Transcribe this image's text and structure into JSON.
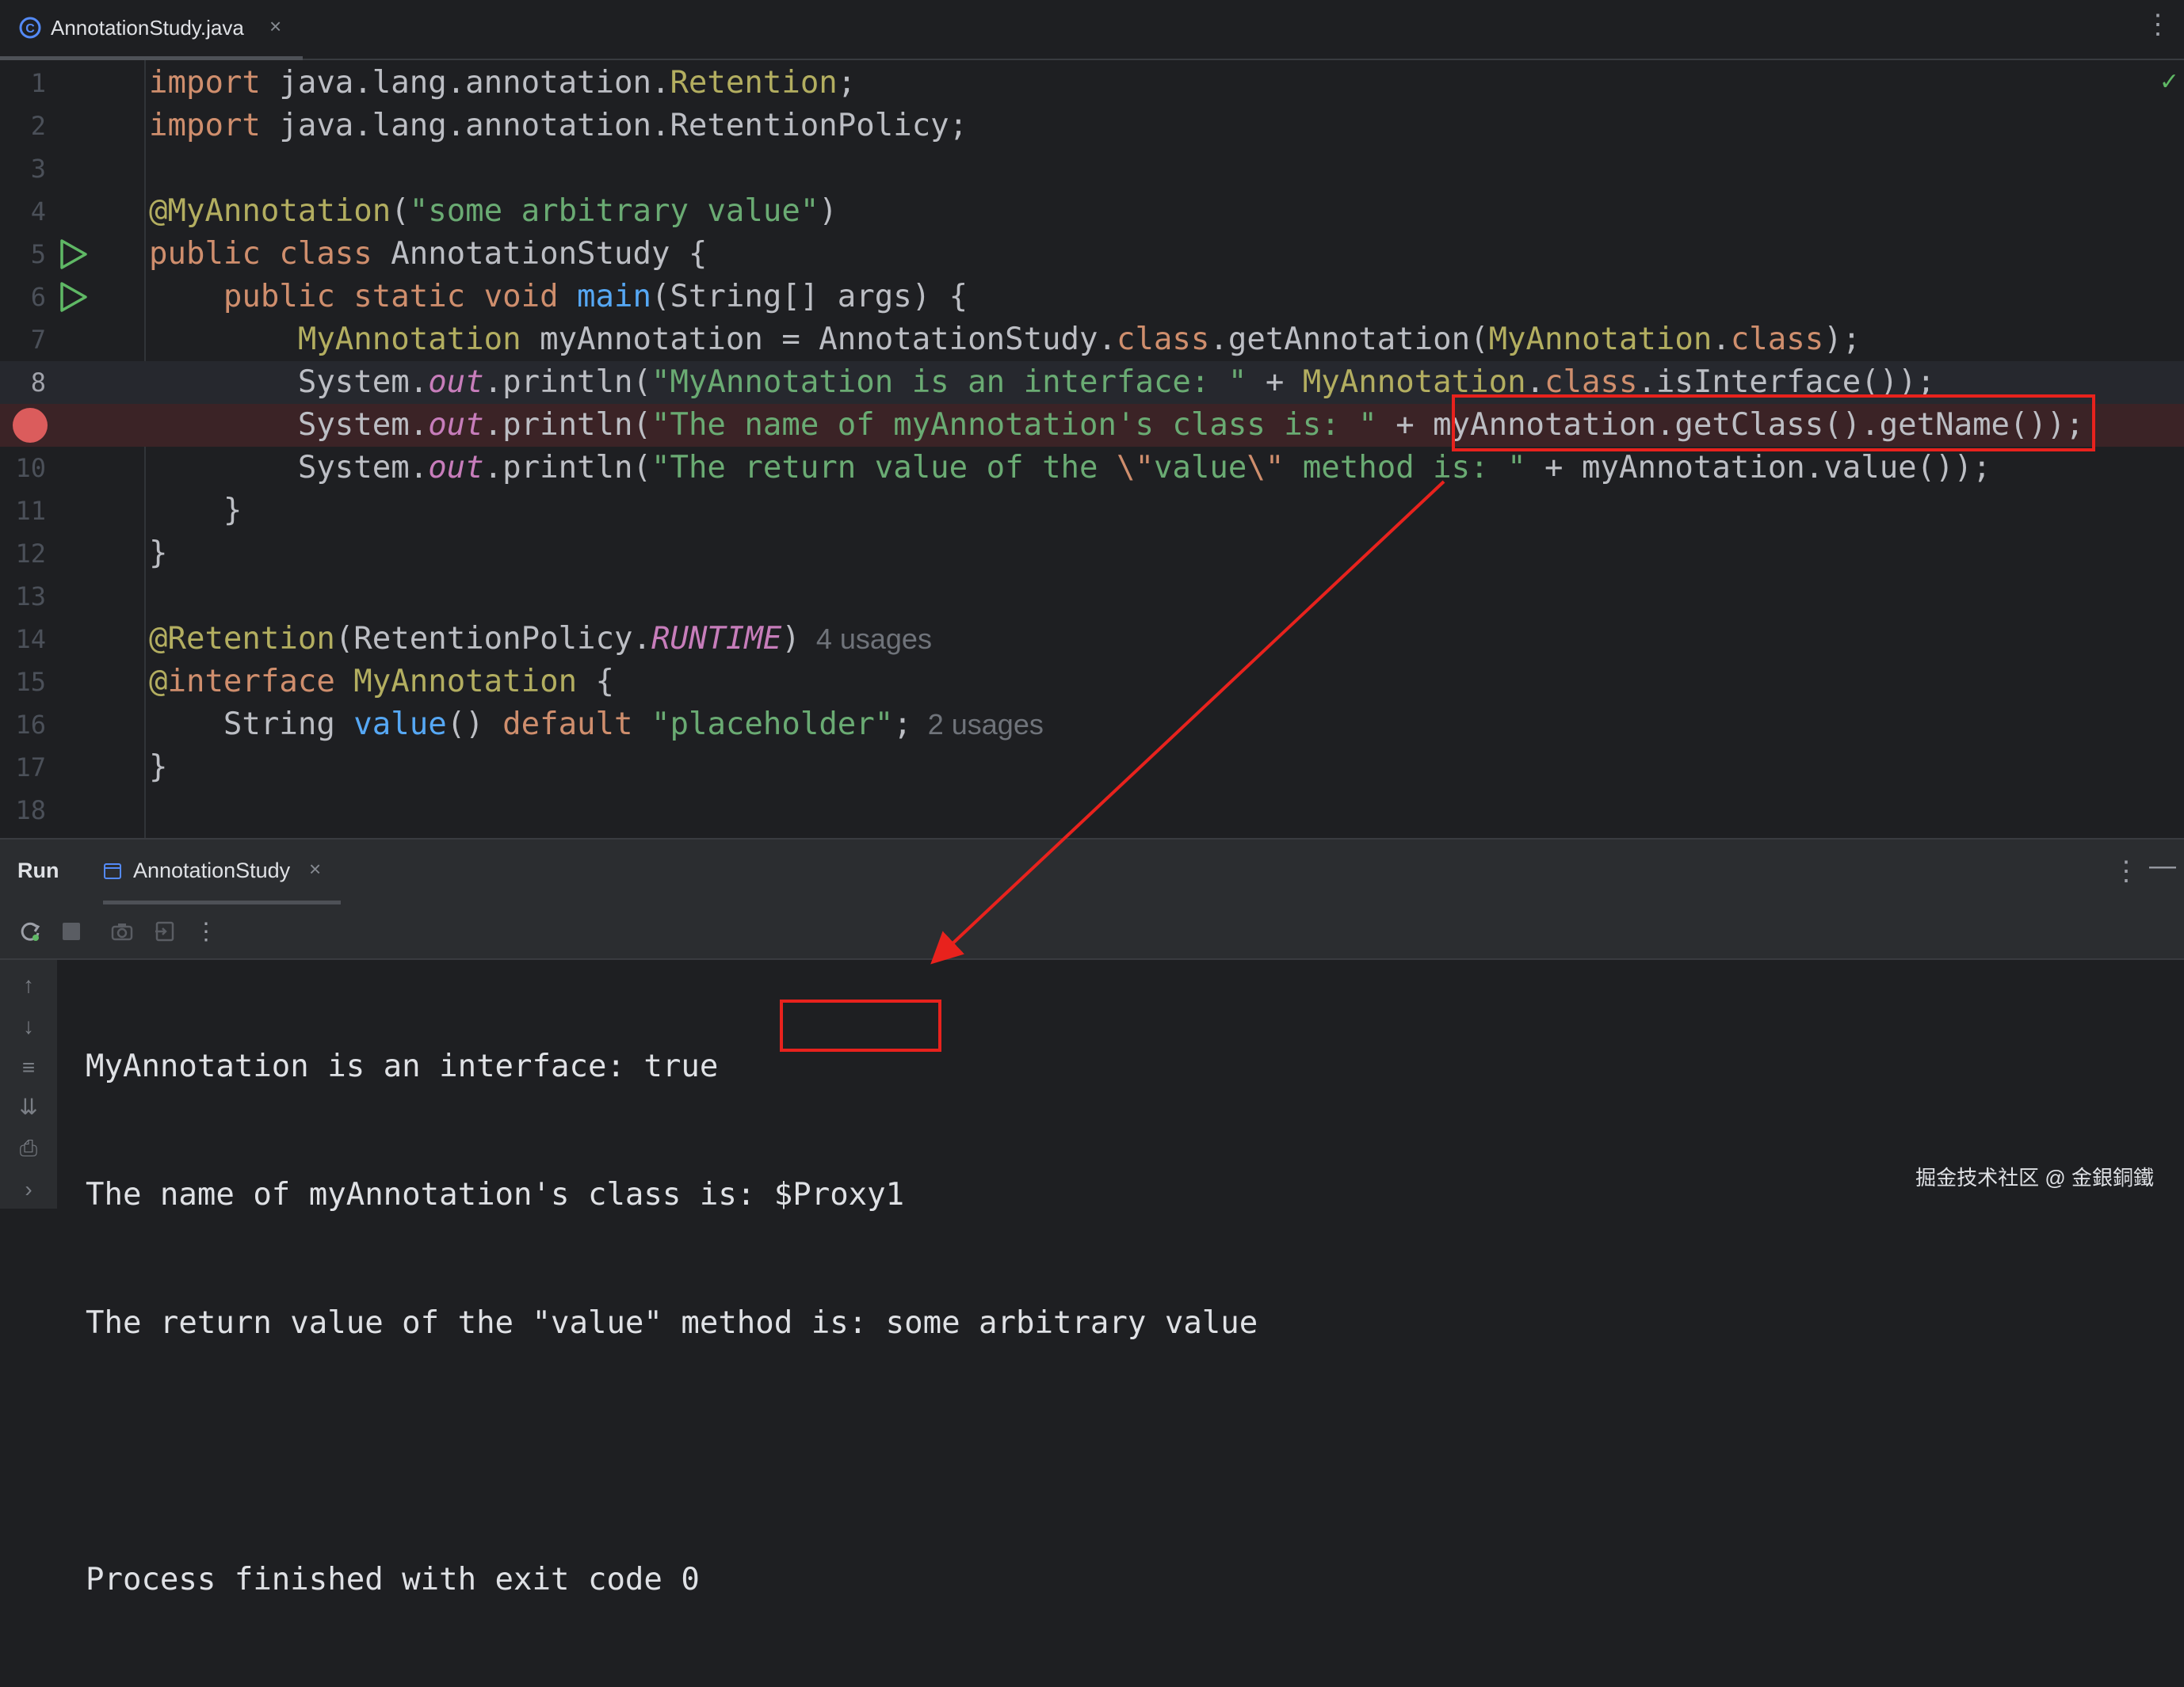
{
  "tab": {
    "label": "AnnotationStudy.java",
    "close": "×",
    "icon": "java-class-icon"
  },
  "editor": {
    "current_line": 8,
    "breakpoint_line": 9,
    "line_numbers": [
      "1",
      "2",
      "3",
      "4",
      "5",
      "6",
      "7",
      "8",
      "",
      "10",
      "11",
      "12",
      "13",
      "14",
      "15",
      "16",
      "17",
      "18"
    ],
    "lines": [
      [
        [
          "kw",
          "import"
        ],
        [
          "t",
          " java.lang.annotation."
        ],
        [
          "an",
          "Retention"
        ],
        [
          "t",
          ";"
        ]
      ],
      [
        [
          "kw",
          "import"
        ],
        [
          "t",
          " java.lang.annotation.RetentionPolicy;"
        ]
      ],
      [],
      [
        [
          "an",
          "@MyAnnotation"
        ],
        [
          "t",
          "("
        ],
        [
          "str",
          "\"some arbitrary value\""
        ],
        [
          "t",
          ")"
        ]
      ],
      [
        [
          "kw",
          "public class"
        ],
        [
          "t",
          " AnnotationStudy {"
        ]
      ],
      [
        [
          "t",
          "    "
        ],
        [
          "kw",
          "public static void"
        ],
        [
          "t",
          " "
        ],
        [
          "fn",
          "main"
        ],
        [
          "t",
          "(String[] args) {"
        ]
      ],
      [
        [
          "t",
          "        "
        ],
        [
          "an",
          "MyAnnotation"
        ],
        [
          "t",
          " myAnnotation = AnnotationStudy."
        ],
        [
          "kw",
          "class"
        ],
        [
          "t",
          ".getAnnotation("
        ],
        [
          "an",
          "MyAnnotation"
        ],
        [
          "t",
          "."
        ],
        [
          "kw",
          "class"
        ],
        [
          "t",
          ");"
        ]
      ],
      [
        [
          "t",
          "        System."
        ],
        [
          "st",
          "out"
        ],
        [
          "t",
          ".println("
        ],
        [
          "str",
          "\"MyAnnotation is an interface: \""
        ],
        [
          "t",
          " + "
        ],
        [
          "an",
          "MyAnnotation"
        ],
        [
          "t",
          "."
        ],
        [
          "kw",
          "class"
        ],
        [
          "t",
          ".isInterface());"
        ]
      ],
      [
        [
          "t",
          "        System."
        ],
        [
          "st",
          "out"
        ],
        [
          "t",
          ".println("
        ],
        [
          "str",
          "\"The name of myAnnotation's class is: \""
        ],
        [
          "t",
          " + myAnnotation.getClass().getName());"
        ]
      ],
      [
        [
          "t",
          "        System."
        ],
        [
          "st",
          "out"
        ],
        [
          "t",
          ".println("
        ],
        [
          "str",
          "\"The return value of the "
        ],
        [
          "kw",
          "\\\""
        ],
        [
          "str",
          "value"
        ],
        [
          "kw",
          "\\\""
        ],
        [
          "str",
          " method is: \""
        ],
        [
          "t",
          " + myAnnotation.value());"
        ]
      ],
      [
        [
          "t",
          "    }"
        ]
      ],
      [
        [
          "t",
          "}"
        ]
      ],
      [],
      [
        [
          "an",
          "@Retention"
        ],
        [
          "t",
          "(RetentionPolicy."
        ],
        [
          "st",
          "RUNTIME"
        ],
        [
          "t",
          ")"
        ],
        [
          "hint",
          "  4 usages"
        ]
      ],
      [
        [
          "an",
          "@"
        ],
        [
          "kw",
          "interface"
        ],
        [
          "t",
          " "
        ],
        [
          "an",
          "MyAnnotation"
        ],
        [
          "t",
          " {"
        ]
      ],
      [
        [
          "t",
          "    String "
        ],
        [
          "fn",
          "value"
        ],
        [
          "t",
          "() "
        ],
        [
          "kw",
          "default"
        ],
        [
          "t",
          " "
        ],
        [
          "str",
          "\"placeholder\""
        ],
        [
          "t",
          ";"
        ],
        [
          "hint",
          "  2 usages"
        ]
      ],
      [
        [
          "t",
          "}"
        ]
      ],
      []
    ]
  },
  "run_panel": {
    "title": "Run",
    "tab_label": "AnnotationStudy",
    "tab_close": "×",
    "console_lines": [
      "MyAnnotation is an interface: true",
      "The name of myAnnotation's class is: $Proxy1",
      "The return value of the \"value\" method is: some arbitrary value",
      "",
      "Process finished with exit code 0"
    ]
  },
  "watermark": "掘金技术社区 @ 金銀銅鐵",
  "colors": {
    "annotation_box": "#e8221d",
    "breakpoint": "#db5c5c"
  }
}
